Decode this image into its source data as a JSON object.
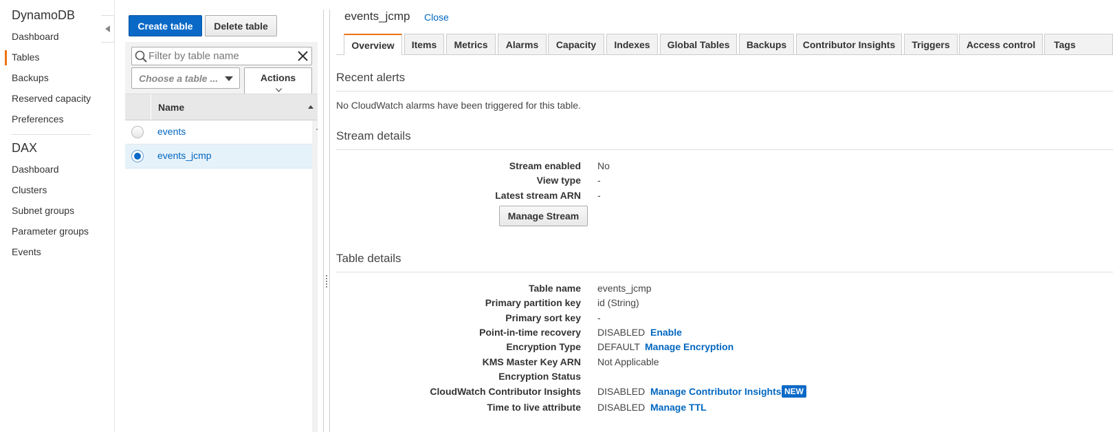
{
  "nav": {
    "dynamo_header": "DynamoDB",
    "dynamo_items": [
      "Dashboard",
      "Tables",
      "Backups",
      "Reserved capacity",
      "Preferences"
    ],
    "active_item": "Tables",
    "dax_header": "DAX",
    "dax_items": [
      "Dashboard",
      "Clusters",
      "Subnet groups",
      "Parameter groups",
      "Events"
    ]
  },
  "toolbar": {
    "create_label": "Create table",
    "delete_label": "Delete table"
  },
  "filter": {
    "placeholder": "Filter by table name",
    "value": ""
  },
  "table_select": {
    "placeholder": "Choose a table ..."
  },
  "actions_label": "Actions",
  "table_list": {
    "column_name": "Name",
    "rows": [
      {
        "name": "events",
        "selected": false
      },
      {
        "name": "events_jcmp",
        "selected": true
      }
    ]
  },
  "detail": {
    "title": "events_jcmp",
    "close_label": "Close",
    "tabs": [
      "Overview",
      "Items",
      "Metrics",
      "Alarms",
      "Capacity",
      "Indexes",
      "Global Tables",
      "Backups",
      "Contributor Insights",
      "Triggers",
      "Access control",
      "Tags"
    ],
    "active_tab": "Overview",
    "recent_alerts": {
      "title": "Recent alerts",
      "message": "No CloudWatch alarms have been triggered for this table."
    },
    "stream": {
      "title": "Stream details",
      "fields": [
        {
          "label": "Stream enabled",
          "value": "No"
        },
        {
          "label": "View type",
          "value": "-"
        },
        {
          "label": "Latest stream ARN",
          "value": "-"
        }
      ],
      "manage_label": "Manage Stream"
    },
    "table": {
      "title": "Table details",
      "table_name_label": "Table name",
      "table_name": "events_jcmp",
      "partition_key_label": "Primary partition key",
      "partition_key": "id (String)",
      "sort_key_label": "Primary sort key",
      "sort_key": "-",
      "pitr_label": "Point-in-time recovery",
      "pitr_value": "DISABLED",
      "pitr_link": "Enable",
      "encryption_type_label": "Encryption Type",
      "encryption_type": "DEFAULT",
      "encryption_link": "Manage Encryption",
      "kms_label": "KMS Master Key ARN",
      "kms_value": "Not Applicable",
      "encryption_status_label": "Encryption Status",
      "encryption_status": "",
      "contrib_label": "CloudWatch Contributor Insights",
      "contrib_value": "DISABLED",
      "contrib_link": "Manage Contributor Insights",
      "contrib_badge": "NEW",
      "ttl_label": "Time to live attribute",
      "ttl_value": "DISABLED",
      "ttl_link": "Manage TTL"
    }
  },
  "colors": {
    "accent_orange": "#ec7211",
    "primary_blue": "#0a69c7",
    "link_blue": "#0066c0",
    "selected_row": "#e6f2fa"
  }
}
